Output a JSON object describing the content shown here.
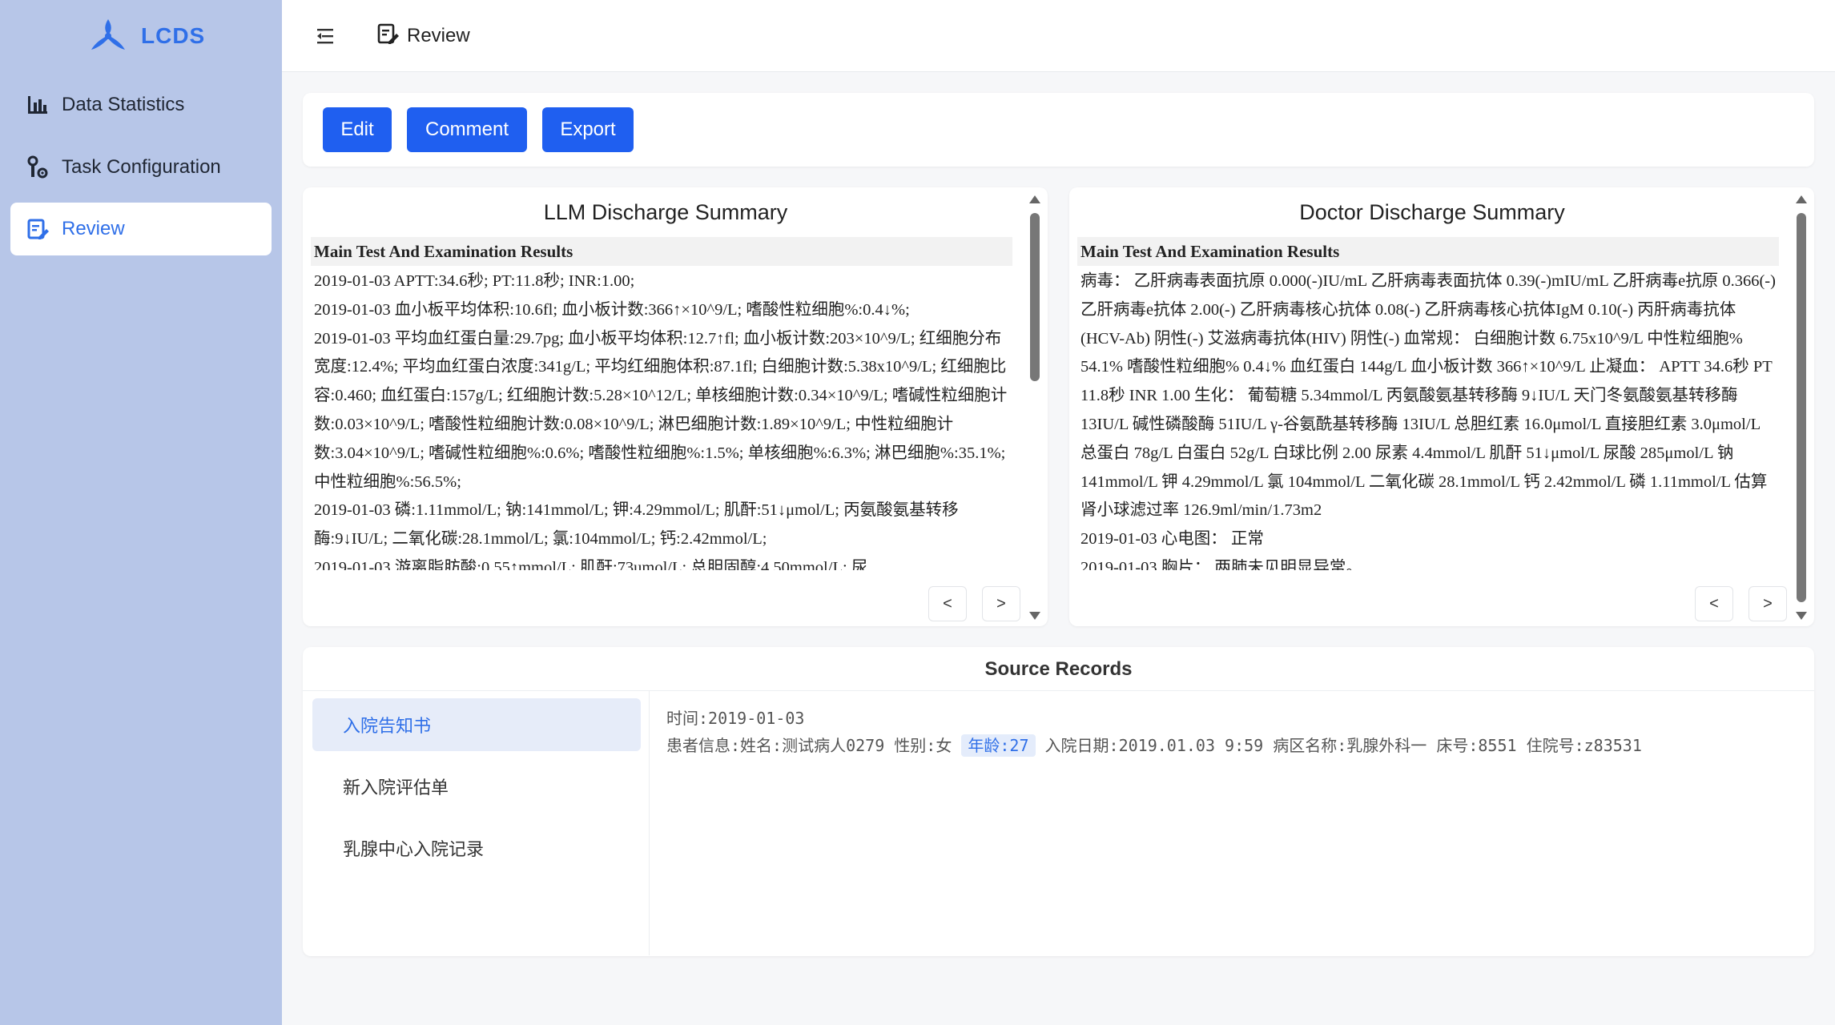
{
  "app": {
    "name": "LCDS",
    "accent": "#1f5ff0"
  },
  "sidebar": {
    "items": [
      {
        "label": "Data Statistics",
        "icon": "bar-chart-icon"
      },
      {
        "label": "Task Configuration",
        "icon": "settings-tools-icon"
      },
      {
        "label": "Review",
        "icon": "review-edit-icon",
        "active": true
      }
    ]
  },
  "header": {
    "breadcrumb": "Review"
  },
  "toolbar": {
    "edit_label": "Edit",
    "comment_label": "Comment",
    "export_label": "Export"
  },
  "llm": {
    "title": "LLM Discharge Summary",
    "section": "Main Test And Examination Results",
    "lines": [
      "2019-01-03 APTT:34.6秒; PT:11.8秒; INR:1.00;",
      "2019-01-03 血小板平均体积:10.6fl; 血小板计数:366↑×10^9/L; 嗜酸性粒细胞%:0.4↓%;",
      "2019-01-03 平均血红蛋白量:29.7pg; 血小板平均体积:12.7↑fl; 血小板计数:203×10^9/L; 红细胞分布宽度:12.4%; 平均血红蛋白浓度:341g/L; 平均红细胞体积:87.1fl; 白细胞计数:5.38x10^9/L; 红细胞比容:0.460; 血红蛋白:157g/L; 红细胞计数:5.28×10^12/L; 单核细胞计数:0.34×10^9/L; 嗜碱性粒细胞计数:0.03×10^9/L; 嗜酸性粒细胞计数:0.08×10^9/L; 淋巴细胞计数:1.89×10^9/L; 中性粒细胞计数:3.04×10^9/L; 嗜碱性粒细胞%:0.6%; 嗜酸性粒细胞%:1.5%; 单核细胞%:6.3%; 淋巴细胞%:35.1%; 中性粒细胞%:56.5%;",
      "2019-01-03 磷:1.11mmol/L; 钠:141mmol/L; 钾:4.29mmol/L; 肌酐:51↓μmol/L; 丙氨酸氨基转移酶:9↓IU/L; 二氧化碳:28.1mmol/L; 氯:104mmol/L; 钙:2.42mmol/L;",
      "2019-01-03 游离脂肪酸:0.55↑mmol/L; 肌酐:73umol/L; 总胆固醇:4.50mmol/L; 尿"
    ],
    "prev": "<",
    "next": ">"
  },
  "doctor": {
    "title": "Doctor Discharge Summary",
    "section": "Main Test And Examination Results",
    "lines": [
      "病毒： 乙肝病毒表面抗原 0.000(-)IU/mL 乙肝病毒表面抗体 0.39(-)mIU/mL 乙肝病毒e抗原 0.366(-) 乙肝病毒e抗体 2.00(-) 乙肝病毒核心抗体 0.08(-) 乙肝病毒核心抗体IgM 0.10(-) 丙肝病毒抗体(HCV-Ab) 阴性(-) 艾滋病毒抗体(HIV) 阴性(-) 血常规： 白细胞计数 6.75x10^9/L 中性粒细胞% 54.1% 嗜酸性粒细胞% 0.4↓% 血红蛋白 144g/L 血小板计数 366↑×10^9/L 止凝血： APTT 34.6秒 PT 11.8秒 INR 1.00 生化： 葡萄糖 5.34mmol/L 丙氨酸氨基转移酶 9↓IU/L 天门冬氨酸氨基转移酶 13IU/L 碱性磷酸酶 51IU/L γ-谷氨酰基转移酶 13IU/L 总胆红素 16.0μmol/L 直接胆红素 3.0μmol/L 总蛋白 78g/L 白蛋白 52g/L 白球比例 2.00 尿素 4.4mmol/L 肌酐 51↓μmol/L 尿酸 285μmol/L 钠 141mmol/L 钾 4.29mmol/L 氯 104mmol/L 二氧化碳 28.1mmol/L 钙 2.42mmol/L 磷 1.11mmol/L 估算肾小球滤过率 126.9ml/min/1.73m2",
      "2019-01-03 心电图： 正常",
      "2019-01-03 胸片： 两肺未见明显异常。"
    ],
    "prev": "<",
    "next": ">"
  },
  "records": {
    "title": "Source Records",
    "tabs": [
      "入院告知书",
      "新入院评估单",
      "乳腺中心入院记录"
    ],
    "content": {
      "time": "时间:2019-01-03",
      "info_prefix": "患者信息:姓名:测试病人0279 性别:女",
      "highlight": "年龄:27",
      "info_suffix": "入院日期:2019.01.03 9:59 病区名称:乳腺外科一 床号:8551 住院号:z83531"
    }
  }
}
